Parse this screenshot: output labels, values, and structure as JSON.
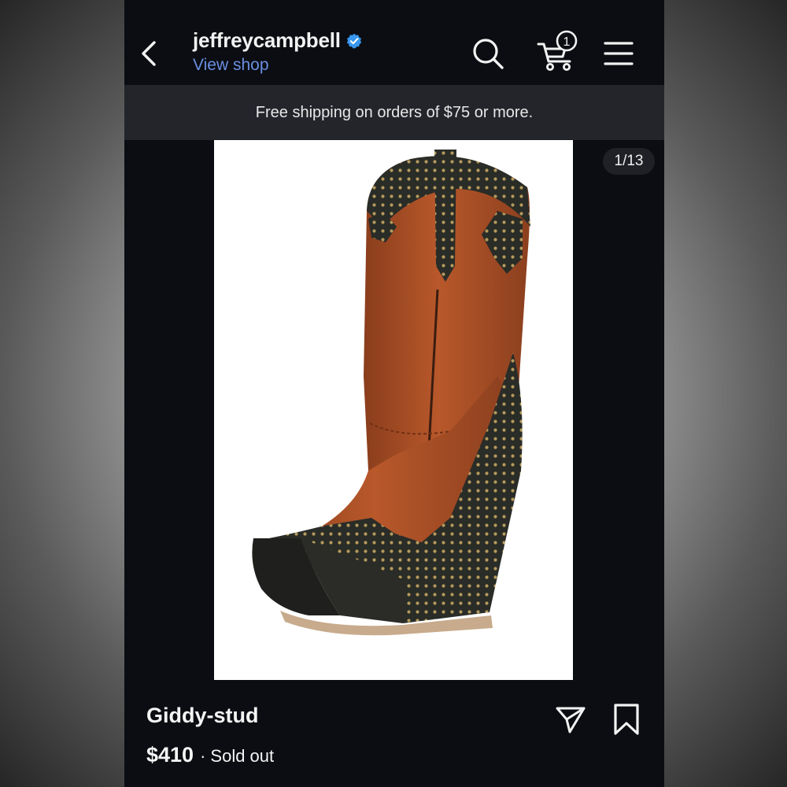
{
  "header": {
    "account_name": "jeffreycampbell",
    "view_shop_label": "View shop",
    "cart_count": "1"
  },
  "banner": {
    "text": "Free shipping on orders of $75 or more."
  },
  "gallery": {
    "counter": "1/13"
  },
  "product": {
    "name": "Giddy-stud",
    "price": "$410",
    "separator": "·",
    "status": "Sold out"
  },
  "colors": {
    "background": "#0b0d12",
    "banner": "#23252b",
    "link": "#6a8fe0",
    "verified": "#3897f0"
  }
}
